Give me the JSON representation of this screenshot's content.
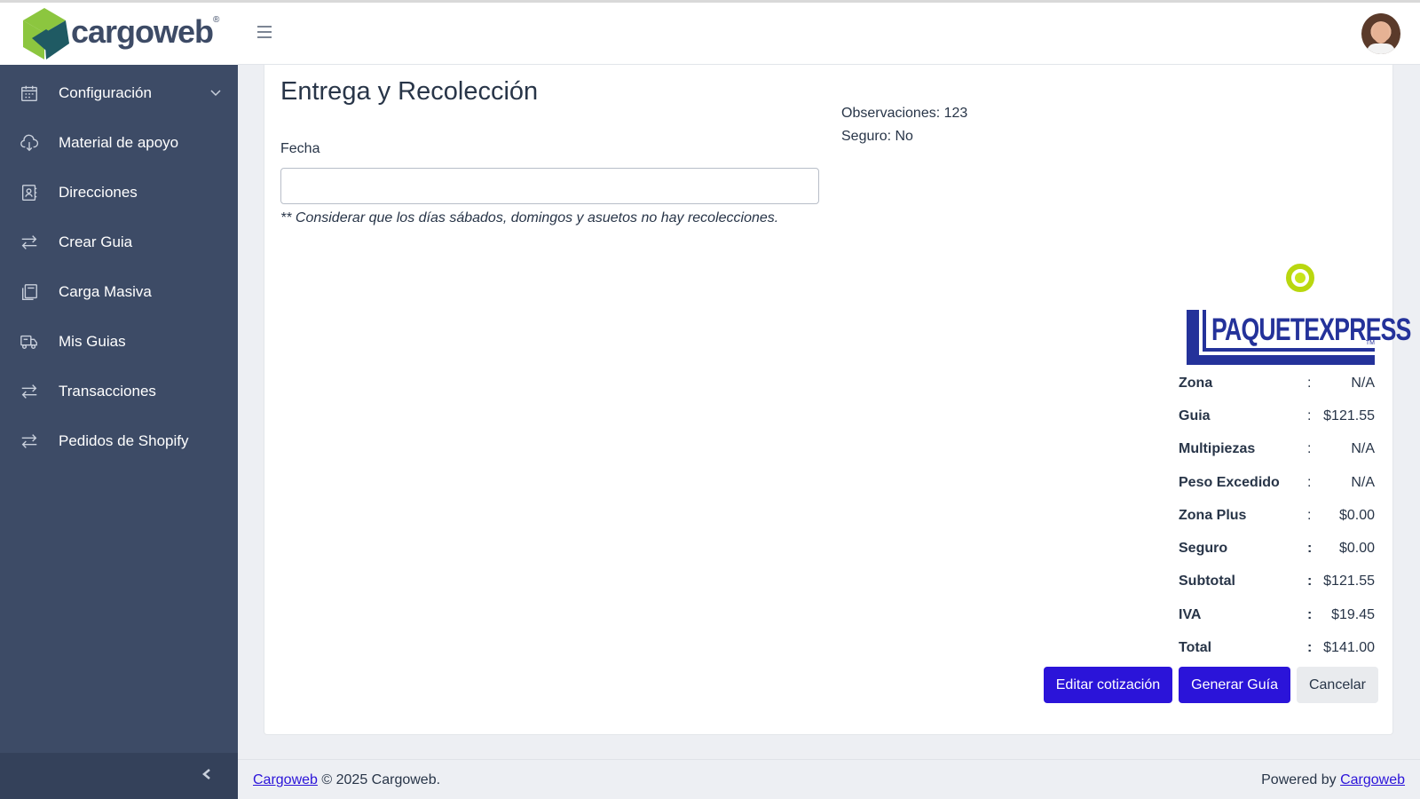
{
  "brand": {
    "name": "cargoweb",
    "registered_mark": "®",
    "colors": {
      "green": "#8cc63f",
      "teal": "#1f5a63",
      "navy": "#3d4b66"
    }
  },
  "sidebar": {
    "items": [
      {
        "label": "Configuración",
        "icon": "calendar-icon",
        "has_submenu": true
      },
      {
        "label": "Material de apoyo",
        "icon": "cloud-download-icon",
        "has_submenu": false
      },
      {
        "label": "Direcciones",
        "icon": "address-book-icon",
        "has_submenu": false
      },
      {
        "label": "Crear Guia",
        "icon": "arrows-exchange-icon",
        "has_submenu": false
      },
      {
        "label": "Carga Masiva",
        "icon": "copy-icon",
        "has_submenu": false
      },
      {
        "label": "Mis Guias",
        "icon": "truck-icon",
        "has_submenu": false
      },
      {
        "label": "Transacciones",
        "icon": "arrows-exchange-icon",
        "has_submenu": false
      },
      {
        "label": "Pedidos de Shopify",
        "icon": "arrows-exchange-icon",
        "has_submenu": false
      }
    ],
    "collapse_icon": "chevron-left-icon"
  },
  "topbar": {
    "menu_icon": "hamburger-icon",
    "avatar_icon": "user-avatar"
  },
  "main": {
    "title": "Entrega y Recolección",
    "fecha_label": "Fecha",
    "fecha_value": "",
    "fecha_note": "** Considerar que los días sábados, domingos y asuetos no hay recolecciones.",
    "observaciones": "Observaciones: 123",
    "seguro": "Seguro: No"
  },
  "carrier": {
    "name": "PAQUETEXPRESS",
    "tm": "TM",
    "color": "#24329a"
  },
  "summary": [
    {
      "label": "Zona",
      "value": "N/A"
    },
    {
      "label": "Guia",
      "value": "$121.55"
    },
    {
      "label": "Multipiezas",
      "value": "N/A"
    },
    {
      "label": "Peso Excedido",
      "value": "N/A"
    },
    {
      "label": "Zona Plus",
      "value": "$0.00"
    },
    {
      "label": "Seguro",
      "value": "$0.00"
    },
    {
      "label": "Subtotal",
      "value": "$121.55"
    },
    {
      "label": "IVA",
      "value": "$19.45"
    },
    {
      "label": "Total",
      "value": "$141.00"
    }
  ],
  "summary_colon": ":",
  "buttons": {
    "edit": "Editar cotización",
    "generate": "Generar Guía",
    "cancel": "Cancelar",
    "primary_color": "#2b14d9"
  },
  "footer": {
    "left_link": "Cargoweb",
    "left_text": " © 2025 Cargoweb.",
    "right_text": "Powered by ",
    "right_link": "Cargoweb"
  }
}
